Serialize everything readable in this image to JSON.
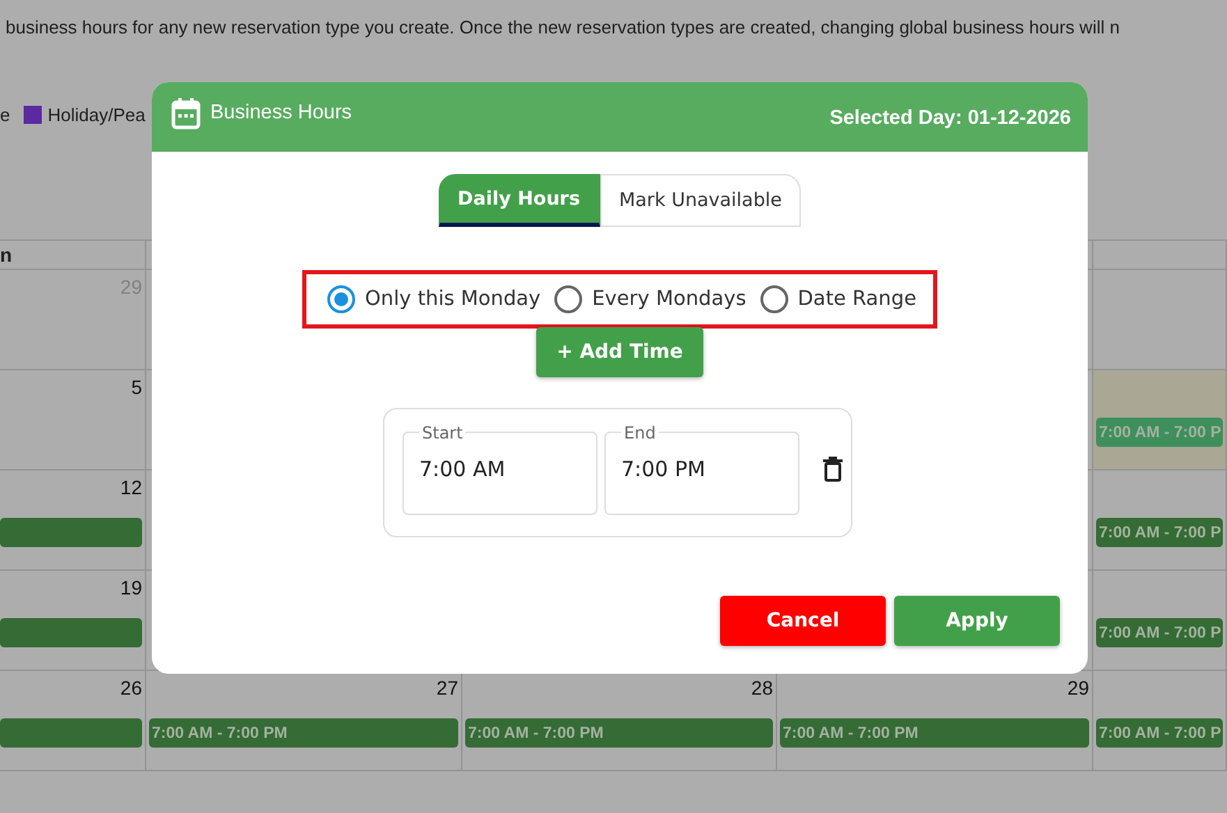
{
  "page": {
    "intro": "business hours for any new reservation type you create. Once the new reservation types are created, changing global business hours will n",
    "legend": [
      {
        "label": "e"
      },
      {
        "label": "Holiday/Pea",
        "color": "#5b2aa0"
      }
    ]
  },
  "calendar": {
    "header": [
      "n"
    ],
    "weeks": [
      {
        "first": {
          "day": "29",
          "muted": true,
          "highlighted": false
        },
        "last": {
          "highlighted": false
        }
      },
      {
        "first": {
          "day": "5",
          "muted": false,
          "highlighted": false
        },
        "last": {
          "highlighted": true,
          "event": {
            "kind": "bar",
            "label": "7:00 AM - 7:00 P"
          }
        }
      },
      {
        "first": {
          "day": "12",
          "muted": false,
          "highlighted": false,
          "event": {
            "kind": "bar"
          }
        },
        "last": {
          "highlighted": false,
          "event": {
            "kind": "bar",
            "label": "7:00 AM - 7:00 P"
          }
        }
      },
      {
        "first": {
          "day": "19",
          "muted": false,
          "highlighted": false,
          "event": {
            "kind": "bar"
          }
        },
        "last": {
          "highlighted": false,
          "event": {
            "kind": "bar",
            "label": "7:00 AM - 7:00 P"
          }
        }
      },
      {
        "first": {
          "day": "26",
          "muted": false,
          "highlighted": false,
          "event": {
            "kind": "bar"
          }
        },
        "middle": [
          {
            "day": "27",
            "muted": false,
            "highlighted": false,
            "event": {
              "kind": "bar",
              "label": "7:00 AM - 7:00 PM"
            }
          },
          {
            "day": "28",
            "muted": false,
            "highlighted": false,
            "event": {
              "kind": "bar",
              "label": "7:00 AM - 7:00 PM"
            }
          },
          {
            "day": "29",
            "muted": false,
            "highlighted": false,
            "event": {
              "kind": "bar",
              "label": "7:00 AM - 7:00 PM"
            }
          }
        ],
        "last": {
          "highlighted": false,
          "event": {
            "kind": "bar",
            "label": "7:00 AM - 7:00 P"
          }
        }
      }
    ]
  },
  "modal": {
    "title": "Business Hours",
    "selected_day": "Selected Day: 01-12-2026",
    "tabs": [
      {
        "label": "Daily Hours",
        "selected": true
      },
      {
        "label": "Mark Unavailable",
        "selected": false
      }
    ],
    "options_outlined": true,
    "options": [
      {
        "label": "Only this Monday",
        "selected": true
      },
      {
        "label": "Every Mondays",
        "selected": false
      },
      {
        "label": "Date Range",
        "selected": false
      }
    ],
    "add_button": "+ Add Time",
    "time_slots": [
      {
        "fields": [
          {
            "label": "Start",
            "value": "7:00 AM"
          },
          {
            "label": "End",
            "value": "7:00 PM"
          }
        ]
      }
    ],
    "buttons": [
      {
        "label": "Cancel",
        "kind": "cancel"
      },
      {
        "label": "Apply",
        "kind": "apply"
      }
    ]
  }
}
